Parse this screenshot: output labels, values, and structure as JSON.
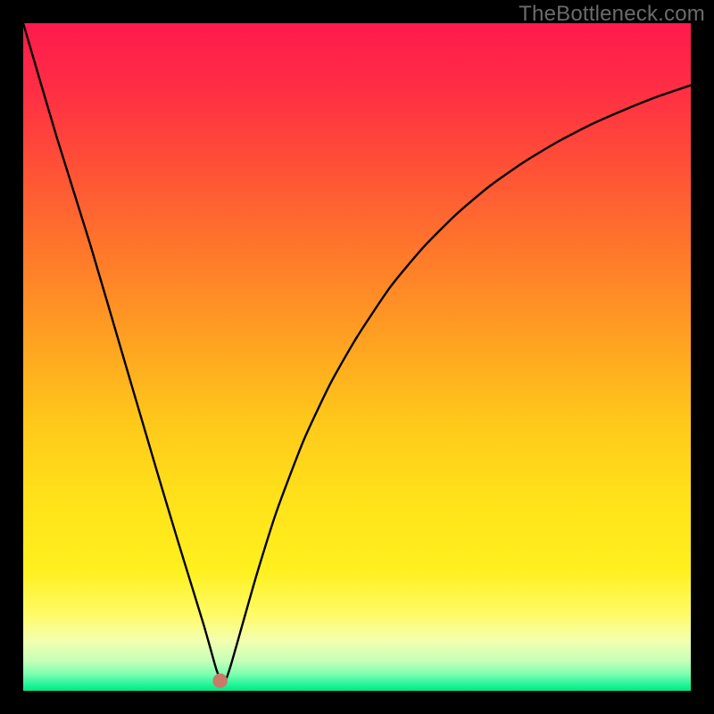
{
  "watermark": "TheBottleneck.com",
  "colors": {
    "frame": "#000000",
    "watermark": "#6b6b6b",
    "curve": "#000000",
    "marker_fill": "#c97b6a",
    "marker_stroke": "#a95e4f",
    "gradient_stops": [
      {
        "offset": 0.0,
        "color": "#ff1a4d"
      },
      {
        "offset": 0.1,
        "color": "#ff2e44"
      },
      {
        "offset": 0.22,
        "color": "#ff5236"
      },
      {
        "offset": 0.35,
        "color": "#ff7a2a"
      },
      {
        "offset": 0.48,
        "color": "#ffa321"
      },
      {
        "offset": 0.6,
        "color": "#ffc91a"
      },
      {
        "offset": 0.72,
        "color": "#ffe31a"
      },
      {
        "offset": 0.82,
        "color": "#fff01f"
      },
      {
        "offset": 0.885,
        "color": "#fffb66"
      },
      {
        "offset": 0.925,
        "color": "#f3ffb0"
      },
      {
        "offset": 0.955,
        "color": "#c6ffb8"
      },
      {
        "offset": 0.975,
        "color": "#7dffb0"
      },
      {
        "offset": 0.99,
        "color": "#26f59a"
      },
      {
        "offset": 1.0,
        "color": "#00e985"
      }
    ]
  },
  "chart_data": {
    "type": "line",
    "title": "",
    "xlabel": "",
    "ylabel": "",
    "xlim": [
      0,
      100
    ],
    "ylim": [
      0,
      100
    ],
    "legend": false,
    "grid": false,
    "marker": {
      "x": 29.5,
      "y": 1.5,
      "r": 1.1
    },
    "series": [
      {
        "name": "bottleneck-curve",
        "x": [
          0,
          5,
          10,
          15,
          20,
          23,
          25,
          27,
          28,
          29,
          30,
          31,
          33,
          35,
          38,
          42,
          46,
          50,
          55,
          60,
          65,
          70,
          75,
          80,
          85,
          90,
          95,
          100
        ],
        "y": [
          100,
          83,
          67,
          50,
          33,
          23,
          16.5,
          10,
          6.5,
          3,
          1,
          3.5,
          10.5,
          17.5,
          27,
          37.5,
          46,
          53,
          60.5,
          66.5,
          71.5,
          75.7,
          79.2,
          82.2,
          84.8,
          87,
          89,
          90.7
        ]
      }
    ]
  }
}
